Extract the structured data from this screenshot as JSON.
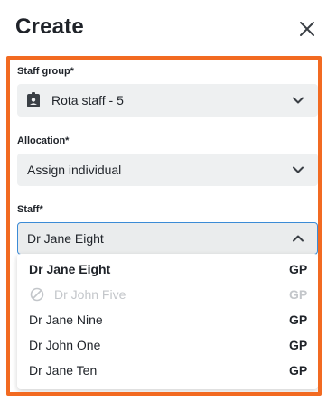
{
  "header": {
    "title": "Create"
  },
  "form": {
    "staff_group": {
      "label": "Staff group*",
      "value": "Rota staff - 5"
    },
    "allocation": {
      "label": "Allocation*",
      "value": "Assign individual"
    },
    "staff": {
      "label": "Staff*",
      "value": "Dr Jane Eight",
      "options": [
        {
          "name": "Dr Jane Eight",
          "group": "GP"
        },
        {
          "name": "Dr John Five",
          "group": "GP"
        },
        {
          "name": "Dr Jane Nine",
          "group": "GP"
        },
        {
          "name": "Dr John One",
          "group": "GP"
        },
        {
          "name": "Dr Jane Ten",
          "group": "GP"
        }
      ]
    }
  },
  "colors": {
    "frame": "#f26a21",
    "focus": "#3b8bd6",
    "field_bg": "#eef0f1",
    "disabled_text": "#c3c6ca"
  },
  "icons": {
    "close": "close-icon",
    "staff_group": "id-badge-icon",
    "disabled": "ban-icon",
    "chevron_down": "chevron-down-icon",
    "chevron_up": "chevron-up-icon"
  }
}
